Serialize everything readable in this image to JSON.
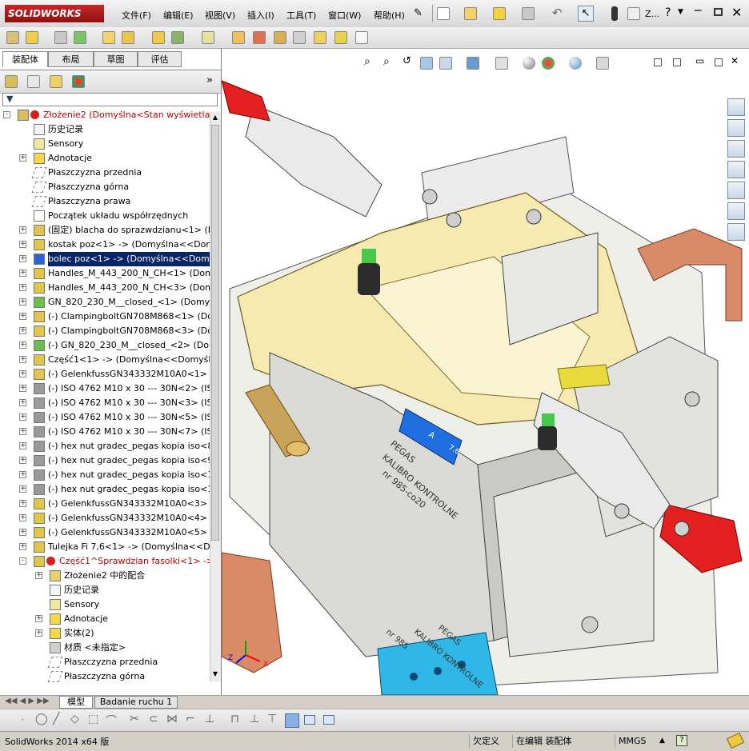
{
  "app": {
    "logo_text": "SOLIDWORKS"
  },
  "menu": [
    "文件(F)",
    "编辑(E)",
    "视图(V)",
    "插入(I)",
    "工具(T)",
    "窗口(W)",
    "帮助(H)"
  ],
  "titlebar": {
    "search_label": "Z..."
  },
  "panel_tabs": [
    "装配体",
    "布局",
    "草图",
    "评估"
  ],
  "tree": [
    {
      "label": "Złożenie2  (Domyślna<Stan wyświetlania-1>)",
      "level": 0,
      "icon": "assembly-icon",
      "red": true,
      "exp": "-"
    },
    {
      "label": "历史记录",
      "level": 1,
      "icon": "history-icon"
    },
    {
      "label": "Sensory",
      "level": 1,
      "icon": "sensor-icon"
    },
    {
      "label": "Adnotacje",
      "level": 1,
      "icon": "annotation-icon",
      "exp": "+"
    },
    {
      "label": "Płaszczyzna przednia",
      "level": 1,
      "icon": "plane-icon"
    },
    {
      "label": "Płaszczyzna górna",
      "level": 1,
      "icon": "plane-icon"
    },
    {
      "label": "Płaszczyzna prawa",
      "level": 1,
      "icon": "plane-icon"
    },
    {
      "label": "Początek układu współrzędnych",
      "level": 1,
      "icon": "origin-icon"
    },
    {
      "label": "(固定) blacha do sprazwdzianu<1> (Domyśln",
      "level": 1,
      "icon": "part-icon",
      "exp": "+"
    },
    {
      "label": "kostak poz<1> -> (Domyślna<<Domyślna>_",
      "level": 1,
      "icon": "part-icon",
      "exp": "+"
    },
    {
      "label": "bolec poz<1> -> (Domyślna<<Domyślna>_S",
      "level": 1,
      "icon": "part-blue-icon",
      "exp": "+",
      "selected": true
    },
    {
      "label": "Handles_M_443_200_N_CH<1> (Domyśln",
      "level": 1,
      "icon": "part-icon",
      "exp": "+"
    },
    {
      "label": "Handles_M_443_200_N_CH<3> (Domyśln",
      "level": 1,
      "icon": "part-icon",
      "exp": "+"
    },
    {
      "label": "GN_820_230_M__closed_<1> (Domyślna<St",
      "level": 1,
      "icon": "subassembly-icon",
      "exp": "+"
    },
    {
      "label": "(-) ClampingboltGN708M868<1> (Domyśln",
      "level": 1,
      "icon": "part-icon",
      "exp": "+"
    },
    {
      "label": "(-) ClampingboltGN708M868<3> (Domyśln",
      "level": 1,
      "icon": "part-icon",
      "exp": "+"
    },
    {
      "label": "(-) GN_820_230_M__closed_<2> (Domyślna",
      "level": 1,
      "icon": "subassembly-icon",
      "exp": "+"
    },
    {
      "label": "Część1<1> -> (Domyślna<<Domyślna>_Sta",
      "level": 1,
      "icon": "part-icon",
      "exp": "+"
    },
    {
      "label": "(-) GelenkfussGN343332M10A0<1> (Domyśl",
      "level": 1,
      "icon": "part-icon",
      "exp": "+"
    },
    {
      "label": "(-) ISO 4762 M10 x 30 --- 30N<2> (ISO 4762",
      "level": 1,
      "icon": "screw-icon",
      "exp": "+"
    },
    {
      "label": "(-) ISO 4762 M10 x 30 --- 30N<3> (ISO 4762",
      "level": 1,
      "icon": "screw-icon",
      "exp": "+"
    },
    {
      "label": "(-) ISO 4762 M10 x 30 --- 30N<5> (ISO 4762",
      "level": 1,
      "icon": "screw-icon",
      "exp": "+"
    },
    {
      "label": "(-) ISO 4762 M10 x 30 --- 30N<7> (ISO 4762",
      "level": 1,
      "icon": "screw-icon",
      "exp": "+"
    },
    {
      "label": "(-) hex nut gradec_pegas kopia iso<8> (Hexa",
      "level": 1,
      "icon": "screw-icon",
      "exp": "+"
    },
    {
      "label": "(-) hex nut gradec_pegas kopia iso<9> (Hexa",
      "level": 1,
      "icon": "screw-icon",
      "exp": "+"
    },
    {
      "label": "(-) hex nut gradec_pegas kopia iso<10> (He:",
      "level": 1,
      "icon": "screw-icon",
      "exp": "+"
    },
    {
      "label": "(-) hex nut gradec_pegas kopia iso<11> (He:",
      "level": 1,
      "icon": "screw-icon",
      "exp": "+"
    },
    {
      "label": "(-) GelenkfussGN343332M10A0<3> (Domyśln",
      "level": 1,
      "icon": "part-icon",
      "exp": "+"
    },
    {
      "label": "(-) GelenkfussGN343332M10A0<4> (Domyśln",
      "level": 1,
      "icon": "part-icon",
      "exp": "+"
    },
    {
      "label": "(-) GelenkfussGN343332M10A0<5> (Domyśln",
      "level": 1,
      "icon": "part-icon",
      "exp": "+"
    },
    {
      "label": "Tulejka Fi 7,6<1> -> (Domyślna<<Domyślna",
      "level": 1,
      "icon": "part-icon",
      "exp": "+"
    },
    {
      "label": "Część1^Sprawdzian fasolki<1> -> (Domy",
      "level": 1,
      "icon": "part-icon",
      "red": true,
      "exp": "-"
    },
    {
      "label": "Złożenie2 中的配合",
      "level": 2,
      "icon": "mates-icon",
      "exp": "+"
    },
    {
      "label": "历史记录",
      "level": 2,
      "icon": "history-icon"
    },
    {
      "label": "Sensory",
      "level": 2,
      "icon": "sensor-icon"
    },
    {
      "label": "Adnotacje",
      "level": 2,
      "icon": "annotation-icon",
      "exp": "+"
    },
    {
      "label": "实体(2)",
      "level": 2,
      "icon": "solid-bodies-icon",
      "exp": "+"
    },
    {
      "label": "材质 <未指定>",
      "level": 2,
      "icon": "material-icon"
    },
    {
      "label": "Płaszczyzna przednia",
      "level": 2,
      "icon": "plane-icon"
    },
    {
      "label": "Płaszczyzna górna",
      "level": 2,
      "icon": "plane-icon"
    }
  ],
  "viewport_text": {
    "engrave1_l1": "PEGAS",
    "engrave1_l2": "KALIBRO KONTROLNE",
    "engrave1_l3": "nr 985-co20",
    "engrave2_l1": "PEGAS",
    "engrave2_l2": "KALIBRO KONTROLNE",
    "engrave2_l3": "nr 985",
    "pin_label_a": "A",
    "pin_label_num": "7.6",
    "triad_x": "X",
    "triad_z": "Z"
  },
  "bottom_tabs": [
    "模型",
    "Badanie ruchu 1"
  ],
  "status": {
    "app_version": "SolidWorks 2014 x64 版",
    "underdefined": "欠定义",
    "editing": "在编辑 装配体",
    "units": "MMGS",
    "help": "?"
  },
  "colors": {
    "selection": "#0a246a",
    "red_text": "#c00000",
    "handle_red": "#e41f1f",
    "blue_part": "#1f6fe0",
    "cyan_part": "#2fb7e8",
    "copper": "#d98a66",
    "yellow_part": "#f2e08a"
  }
}
